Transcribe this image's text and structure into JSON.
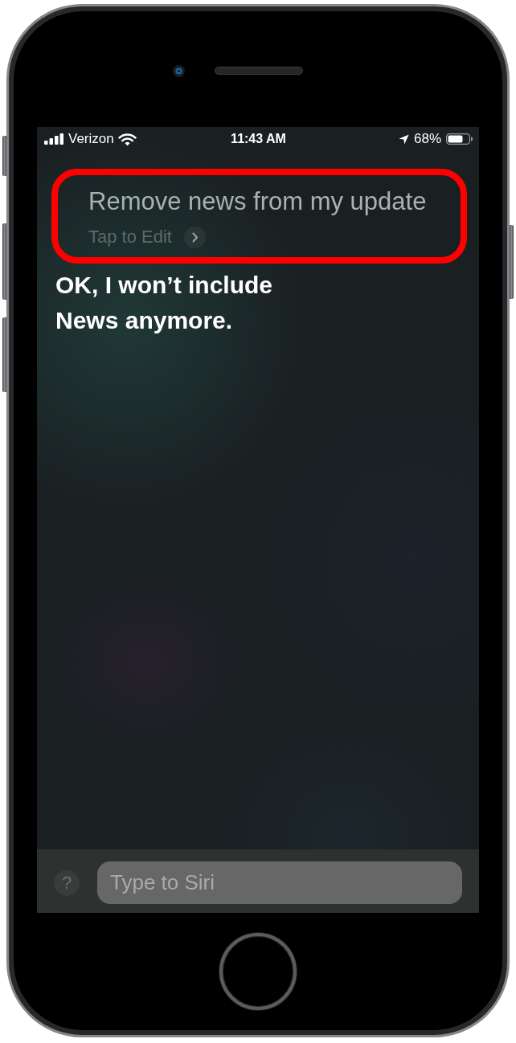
{
  "status_bar": {
    "carrier": "Verizon",
    "time": "11:43 AM",
    "location_services": true,
    "battery_percent": "68%"
  },
  "siri": {
    "query": "Remove news from my update",
    "edit_label": "Tap to Edit",
    "highlighted": true,
    "response": "OK, I won’t include News anymore."
  },
  "input_bar": {
    "help": "?",
    "placeholder": "Type to Siri"
  }
}
